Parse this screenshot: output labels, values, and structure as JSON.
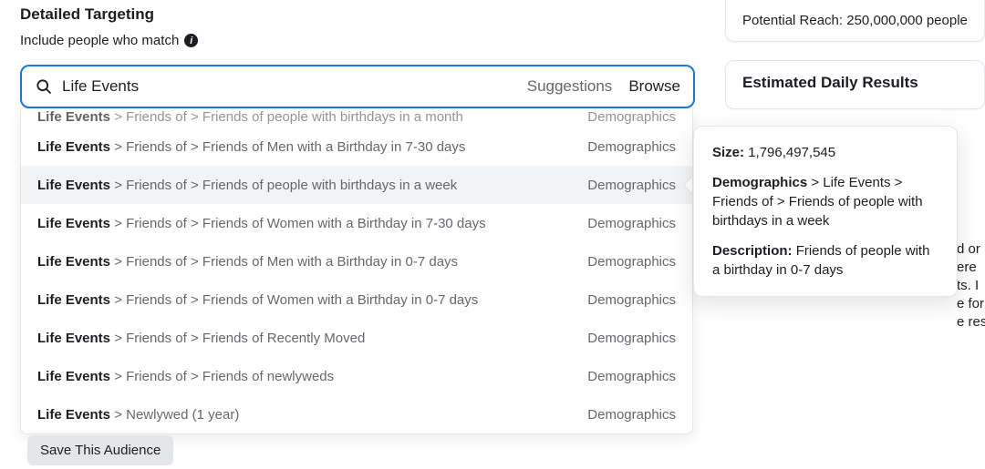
{
  "section": {
    "title": "Detailed Targeting",
    "subtitle": "Include people who match"
  },
  "search": {
    "value": "Life Events",
    "suggestions_label": "Suggestions",
    "browse_label": "Browse"
  },
  "truncated": {
    "root": "Life Events",
    "rest": " > Friends of > Friends of people with birthdays in a month",
    "category": "Demographics"
  },
  "options": [
    {
      "root": "Life Events",
      "rest": " > Friends of > Friends of Men with a Birthday in 7-30 days",
      "category": "Demographics",
      "selected": false
    },
    {
      "root": "Life Events",
      "rest": " > Friends of > Friends of people with birthdays in a week",
      "category": "Demographics",
      "selected": true
    },
    {
      "root": "Life Events",
      "rest": " > Friends of > Friends of Women with a Birthday in 7-30 days",
      "category": "Demographics",
      "selected": false
    },
    {
      "root": "Life Events",
      "rest": " > Friends of > Friends of Men with a Birthday in 0-7 days",
      "category": "Demographics",
      "selected": false
    },
    {
      "root": "Life Events",
      "rest": " > Friends of > Friends of Women with a Birthday in 0-7 days",
      "category": "Demographics",
      "selected": false
    },
    {
      "root": "Life Events",
      "rest": " > Friends of > Friends of Recently Moved",
      "category": "Demographics",
      "selected": false
    },
    {
      "root": "Life Events",
      "rest": " > Friends of > Friends of newlyweds",
      "category": "Demographics",
      "selected": false
    },
    {
      "root": "Life Events",
      "rest": " > Newlywed (1 year)",
      "category": "Demographics",
      "selected": false
    }
  ],
  "save_button": "Save This Audience",
  "sidebar": {
    "reach_label": "Potential Reach: ",
    "reach_value": "250,000,000 people",
    "est_title": "Estimated Daily Results",
    "bg_text": "d or\nere\nts. I\ne for\ne res"
  },
  "tooltip": {
    "size_label": "Size:",
    "size_value": "1,796,497,545",
    "path_label": "Demographics",
    "path_rest": " > Life Events > Friends of > Friends of people with birthdays in a week",
    "desc_label": "Description:",
    "desc_value": "Friends of people with a birthday in 0-7 days"
  }
}
